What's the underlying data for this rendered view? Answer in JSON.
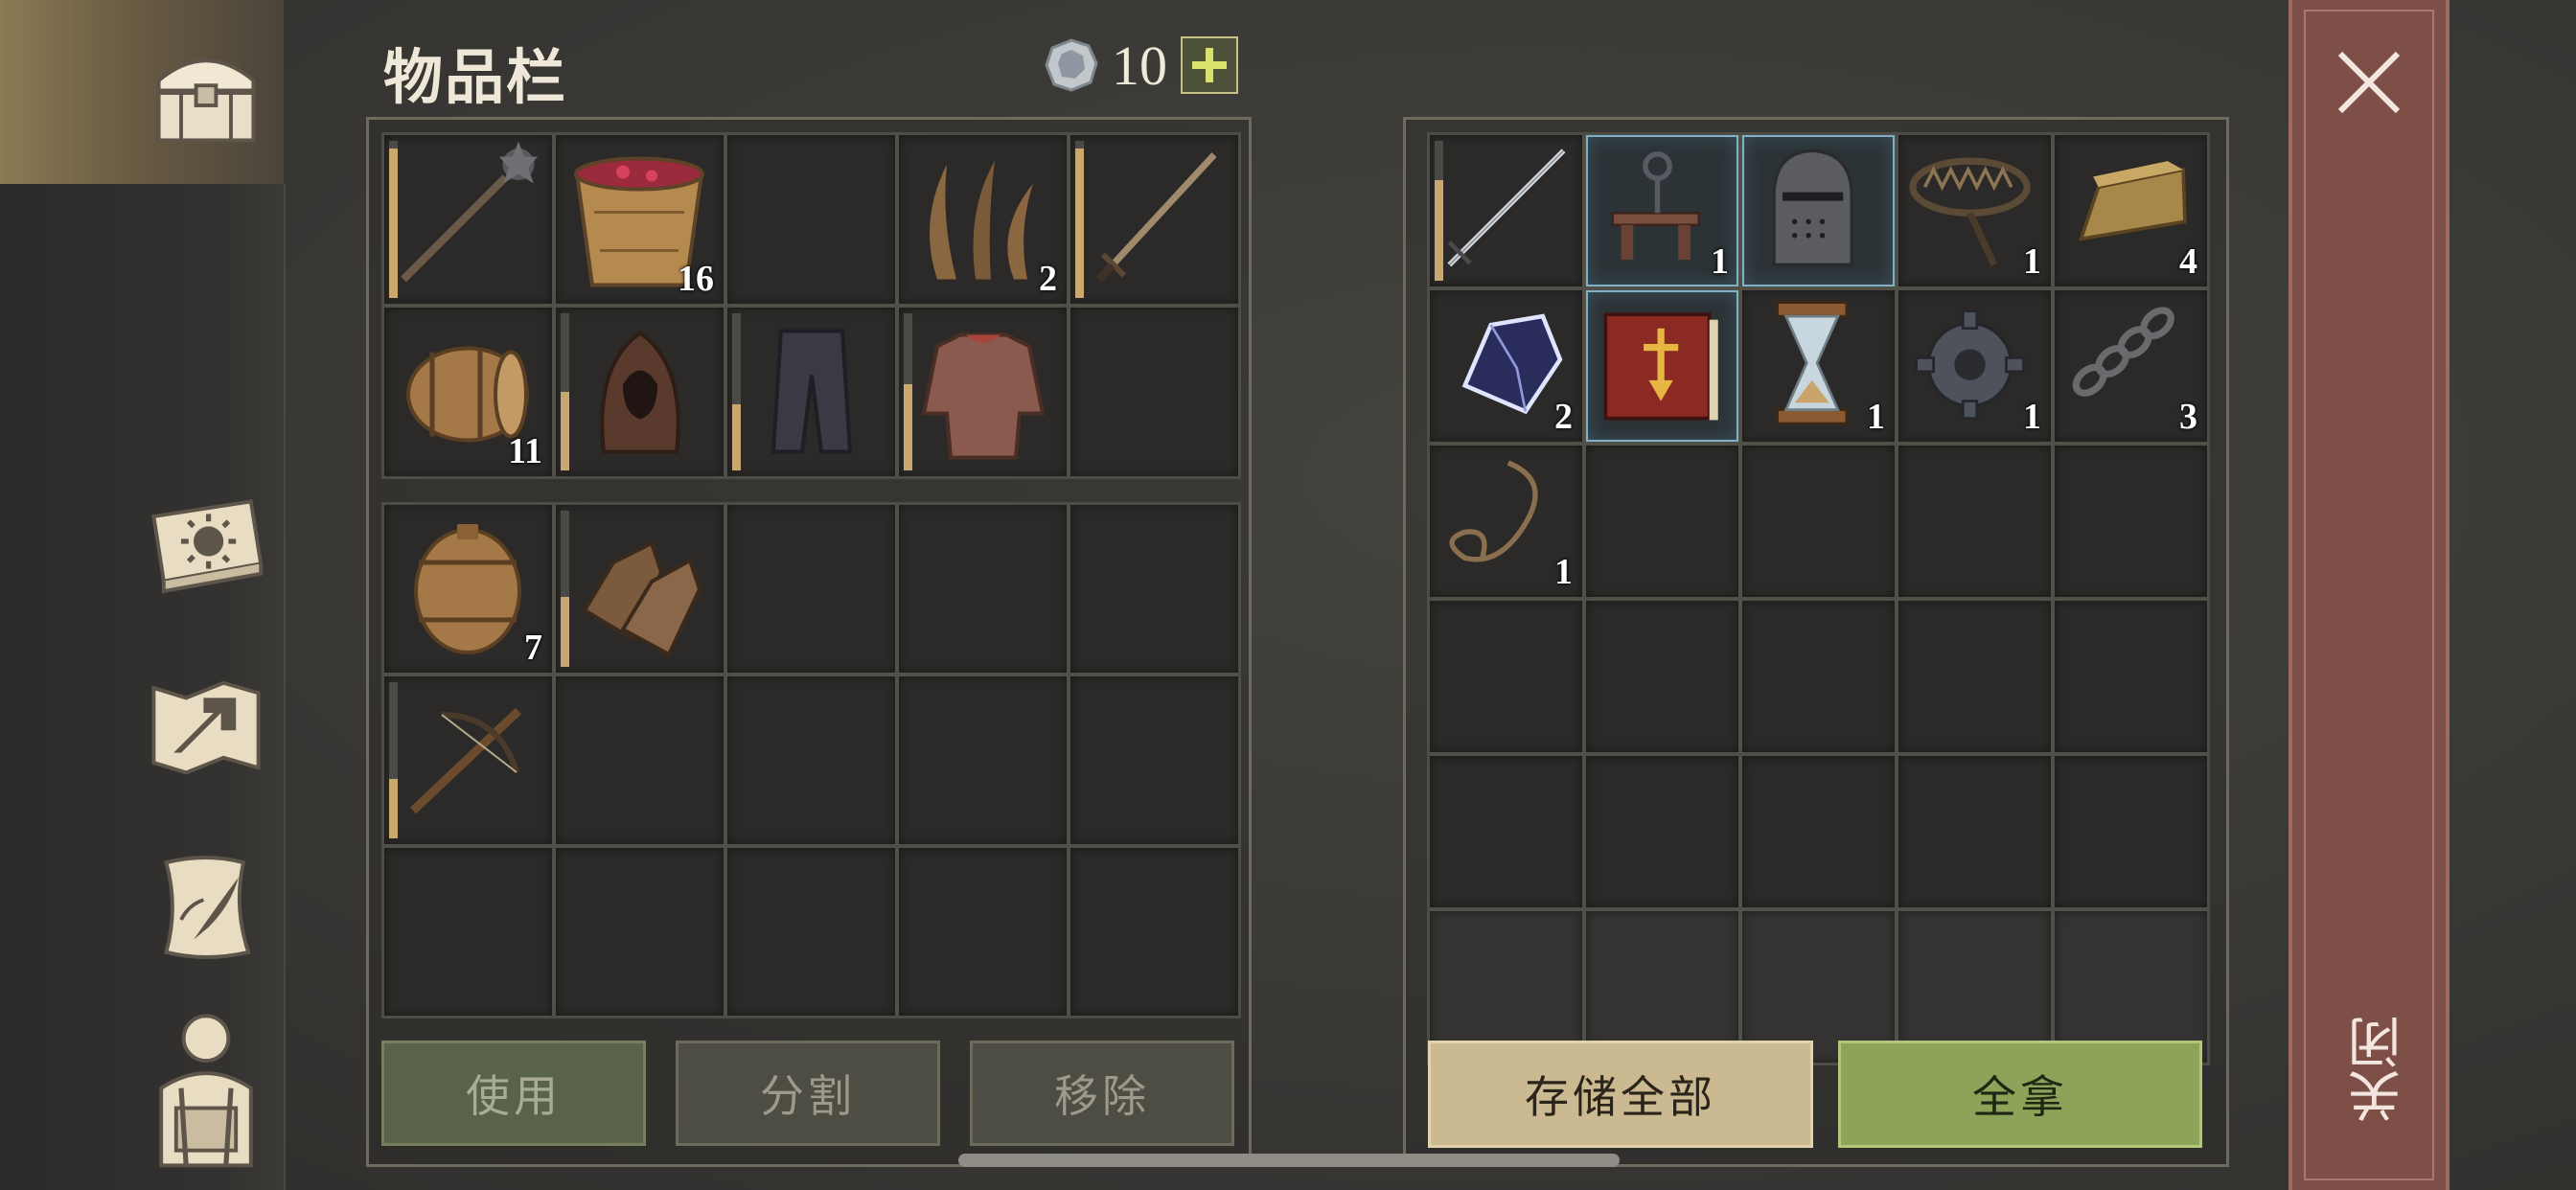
{
  "header": {
    "title": "物品栏",
    "currency": "10",
    "add_label": "+"
  },
  "close": {
    "label": "关闭"
  },
  "inventory": {
    "equip": [
      {
        "icon": "mace",
        "durability": 0.95,
        "count": ""
      },
      {
        "icon": "berry-bucket",
        "count": "16"
      },
      {
        "icon": "",
        "count": ""
      },
      {
        "icon": "plant-fiber",
        "count": "2"
      },
      {
        "icon": "sword",
        "durability": 0.95,
        "count": ""
      },
      {
        "icon": "barrel-barrel",
        "count": "11"
      },
      {
        "icon": "hood",
        "durability": 0.5,
        "count": ""
      },
      {
        "icon": "pants",
        "durability": 0.42,
        "count": ""
      },
      {
        "icon": "chainmail",
        "durability": 0.55,
        "count": ""
      },
      {
        "icon": "",
        "count": ""
      }
    ],
    "bag": [
      {
        "icon": "keg",
        "count": "7"
      },
      {
        "icon": "gloves",
        "durability": 0.45,
        "count": ""
      },
      {
        "icon": "",
        "count": ""
      },
      {
        "icon": "",
        "count": ""
      },
      {
        "icon": "",
        "count": ""
      },
      {
        "icon": "crossbow",
        "durability": 0.38,
        "count": ""
      },
      {
        "icon": "",
        "count": ""
      },
      {
        "icon": "",
        "count": ""
      },
      {
        "icon": "",
        "count": ""
      },
      {
        "icon": "",
        "count": ""
      },
      {
        "icon": "",
        "count": ""
      },
      {
        "icon": "",
        "count": ""
      },
      {
        "icon": "",
        "count": ""
      },
      {
        "icon": "",
        "count": ""
      },
      {
        "icon": "",
        "count": ""
      }
    ],
    "buttons": {
      "use": "使用",
      "split": "分割",
      "remove": "移除"
    }
  },
  "storage": {
    "slots": [
      {
        "icon": "longsword",
        "durability": 0.72,
        "count": ""
      },
      {
        "icon": "key-rack",
        "count": "1",
        "highlight": true
      },
      {
        "icon": "helmet",
        "count": "",
        "highlight": true
      },
      {
        "icon": "bear-trap",
        "count": "1"
      },
      {
        "icon": "ingot",
        "count": "4"
      },
      {
        "icon": "crystal",
        "count": "2"
      },
      {
        "icon": "book",
        "count": "",
        "highlight": true
      },
      {
        "icon": "hourglass",
        "count": "1"
      },
      {
        "icon": "gear",
        "count": "1"
      },
      {
        "icon": "chain",
        "count": "3"
      },
      {
        "icon": "rope",
        "count": "1"
      },
      {
        "icon": "",
        "count": ""
      },
      {
        "icon": "",
        "count": ""
      },
      {
        "icon": "",
        "count": ""
      },
      {
        "icon": "",
        "count": ""
      },
      {
        "icon": "",
        "count": ""
      },
      {
        "icon": "",
        "count": ""
      },
      {
        "icon": "",
        "count": ""
      },
      {
        "icon": "",
        "count": ""
      },
      {
        "icon": "",
        "count": ""
      },
      {
        "icon": "",
        "count": ""
      },
      {
        "icon": "",
        "count": ""
      },
      {
        "icon": "",
        "count": ""
      },
      {
        "icon": "",
        "count": ""
      },
      {
        "icon": "",
        "count": ""
      },
      {
        "icon": "",
        "count": ""
      },
      {
        "icon": "",
        "count": ""
      },
      {
        "icon": "",
        "count": ""
      },
      {
        "icon": "",
        "count": ""
      },
      {
        "icon": "",
        "count": ""
      }
    ],
    "buttons": {
      "store_all": "存储全部",
      "take_all": "全拿"
    }
  },
  "sidebar": [
    "chest-icon",
    "sun-book-icon",
    "map-arrow-icon",
    "scroll-quill-icon",
    "character-backpack-icon"
  ],
  "colors": {
    "durability": "#c9a76e",
    "take_all": "#8da35a",
    "store_all": "#cbb991",
    "close": "#7e4f47"
  }
}
